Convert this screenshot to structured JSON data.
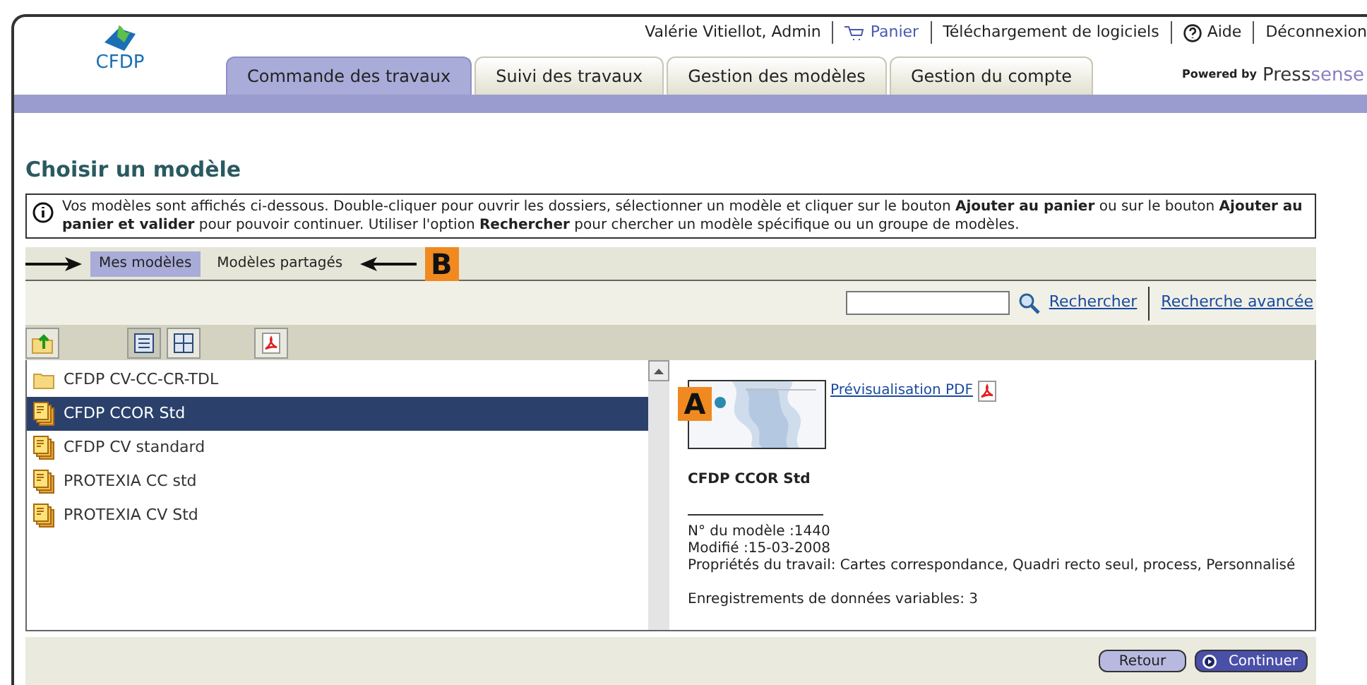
{
  "logo": {
    "text": "CFDP"
  },
  "top_links": [
    {
      "kind": "text",
      "label": "Valérie Vitiellot, Admin"
    },
    {
      "kind": "cart",
      "label": "Panier"
    },
    {
      "kind": "text",
      "label": "Téléchargement de logiciels"
    },
    {
      "kind": "help",
      "label": "Aide"
    },
    {
      "kind": "text",
      "label": "Déconnexion"
    }
  ],
  "tabs": [
    {
      "label": "Commande des travaux",
      "selected": true
    },
    {
      "label": "Suivi des travaux",
      "selected": false
    },
    {
      "label": "Gestion des modèles",
      "selected": false
    },
    {
      "label": "Gestion du compte",
      "selected": false
    }
  ],
  "powered_by": {
    "prefix": "Powered by",
    "brand": "Press",
    "brand_suffix": "sense"
  },
  "page_title": "Choisir un modèle",
  "info": "Vos modèles sont affichés ci-dessous. Double-cliquer pour ouvrir les dossiers, sélectionner un modèle et cliquer sur le bouton **Ajouter au panier** ou sur le bouton **Ajouter au panier et valider** pour pouvoir continuer. Utiliser l'option **Rechercher** pour chercher un modèle spécifique ou un groupe de modèles.",
  "subtabs": [
    {
      "label": "Mes modèles",
      "selected": true
    },
    {
      "label": "Modèles partagés",
      "selected": false
    }
  ],
  "search": {
    "button": "Rechercher",
    "advanced": "Recherche avancée"
  },
  "toolbar": [
    {
      "kind": "up"
    },
    {
      "kind": "list",
      "selected": true
    },
    {
      "kind": "grid",
      "selected": false
    },
    {
      "kind": "pdf"
    }
  ],
  "models": [
    {
      "kind": "folder",
      "name": "CFDP CV-CC-CR-TDL",
      "selected": false
    },
    {
      "kind": "model",
      "name": "CFDP CCOR Std",
      "selected": true
    },
    {
      "kind": "model",
      "name": "CFDP CV standard",
      "selected": false
    },
    {
      "kind": "model",
      "name": "PROTEXIA CC std",
      "selected": false
    },
    {
      "kind": "model",
      "name": "PROTEXIA CV Std",
      "selected": false
    }
  ],
  "detail": {
    "preview_link": "Prévisualisation PDF",
    "name": "CFDP CCOR Std",
    "lines": [
      "N° du modèle :1440",
      "Modifié :15-03-2008",
      "Propriétés du travail: Cartes correspondance, Quadri recto seul, process, Personnalisé"
    ],
    "variables": "Enregistrements de données variables: 3"
  },
  "buttons": [
    {
      "kind": "plain",
      "label": "Retour"
    },
    {
      "kind": "primary",
      "label": "Continuer"
    }
  ],
  "callouts": [
    {
      "label": "A"
    },
    {
      "label": "B"
    }
  ]
}
